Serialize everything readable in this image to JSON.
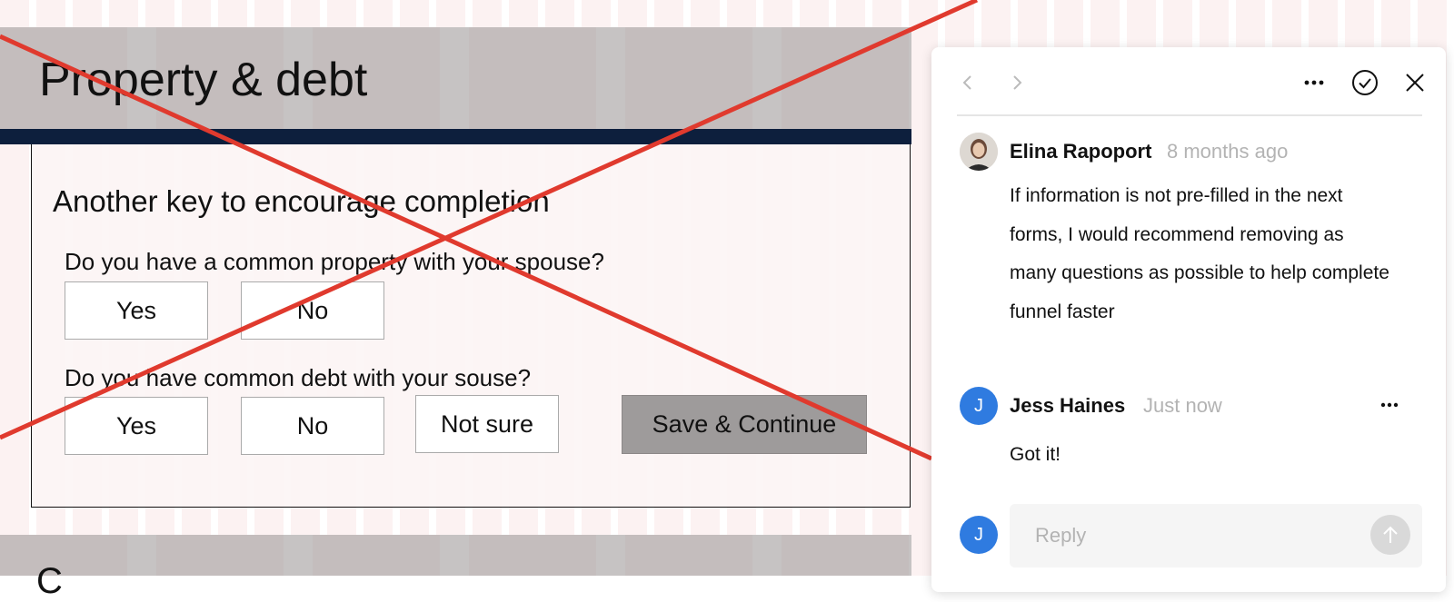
{
  "form": {
    "title": "Property & debt",
    "section_heading": "Another key to encourage completion",
    "question1": "Do you have a common property with your spouse?",
    "question1_options": [
      "Yes",
      "No"
    ],
    "question2": "Do you have common debt with your souse?",
    "question2_options": [
      "Yes",
      "No",
      "Not sure"
    ],
    "save_button": "Save & Continue",
    "next_section_partial": "C"
  },
  "comments": [
    {
      "author": "Elina Rapoport",
      "time": "8 months ago",
      "text": "If information is not pre-filled in the next forms, I would recommend removing as many questions as possible to help complete funnel faster"
    },
    {
      "author": "Jess Haines",
      "avatar_initial": "J",
      "time": "Just now",
      "text": "Got it!"
    }
  ],
  "reply": {
    "avatar_initial": "J",
    "placeholder": "Reply"
  },
  "icons": {
    "prev": "chevron-left-icon",
    "next": "chevron-right-icon",
    "more": "more-horizontal-icon",
    "resolve": "check-circle-icon",
    "close": "close-icon",
    "send": "arrow-up-icon"
  },
  "colors": {
    "cross_red": "#e03a2e",
    "navy": "#0d1f3d",
    "avatar_blue": "#2f7be0"
  }
}
